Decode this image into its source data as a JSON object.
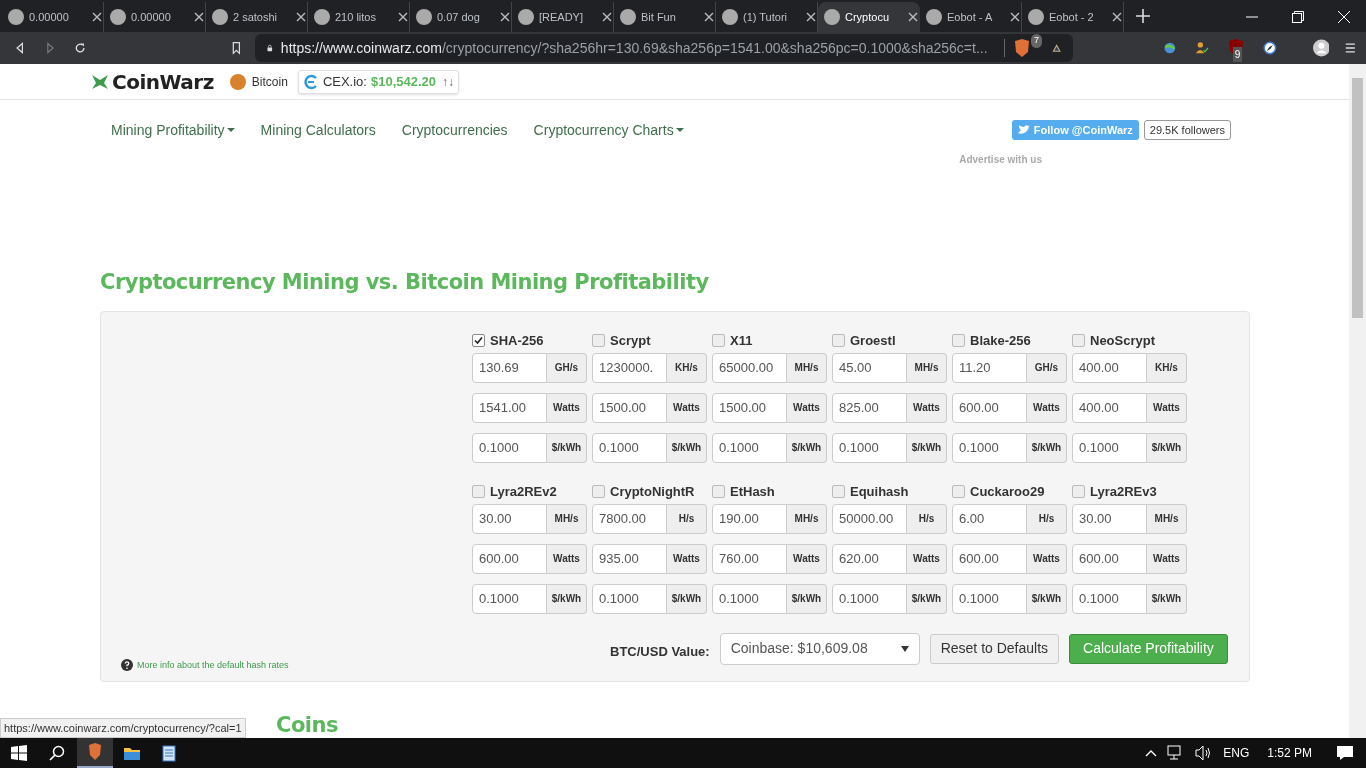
{
  "browser": {
    "tabs": [
      {
        "title": "0.00000",
        "selected": false
      },
      {
        "title": "0.00000",
        "selected": false
      },
      {
        "title": "2 satoshi",
        "selected": false
      },
      {
        "title": "210 litos",
        "selected": false
      },
      {
        "title": "0.07 dog",
        "selected": false
      },
      {
        "title": "[READY]",
        "selected": false
      },
      {
        "title": "Bit Fun",
        "selected": false
      },
      {
        "title": "(1) Tutori",
        "selected": false
      },
      {
        "title": "Cryptocu",
        "selected": true
      },
      {
        "title": "Eobot - A",
        "selected": false
      },
      {
        "title": "Eobot - 2",
        "selected": false
      }
    ],
    "url_host": "https://www.coinwarz.com",
    "url_path": "/cryptocurrency/?sha256hr=130.69&sha256p=1541.00&sha256pc=0.1000&sha256c=t...",
    "shield_count": "7",
    "ublock_count": "9"
  },
  "header": {
    "logo": "CoinWarz",
    "coin": "Bitcoin",
    "exchange": "CEX.io:",
    "price": "$10,542.20",
    "arrows": "↑↓"
  },
  "nav": [
    {
      "label": "Mining Profitability",
      "dropdown": true
    },
    {
      "label": "Mining Calculators",
      "dropdown": false
    },
    {
      "label": "Cryptocurrencies",
      "dropdown": false
    },
    {
      "label": "Cryptocurrency Charts",
      "dropdown": true
    }
  ],
  "twitter": {
    "button": "Follow @CoinWarz",
    "followers": "29.5K followers"
  },
  "advertise": "Advertise with us",
  "title": "Cryptocurrency Mining vs. Bitcoin Mining Profitability",
  "algorithms": [
    {
      "name": "SHA-256",
      "checked": true,
      "hashrate": "130.69",
      "hash_unit": "GH/s",
      "power": "1541.00",
      "power_unit": "Watts",
      "cost": "0.1000",
      "cost_unit": "$/kWh"
    },
    {
      "name": "Scrypt",
      "checked": false,
      "hashrate": "1230000.",
      "hash_unit": "KH/s",
      "power": "1500.00",
      "power_unit": "Watts",
      "cost": "0.1000",
      "cost_unit": "$/kWh"
    },
    {
      "name": "X11",
      "checked": false,
      "hashrate": "65000.00",
      "hash_unit": "MH/s",
      "power": "1500.00",
      "power_unit": "Watts",
      "cost": "0.1000",
      "cost_unit": "$/kWh"
    },
    {
      "name": "Groestl",
      "checked": false,
      "hashrate": "45.00",
      "hash_unit": "MH/s",
      "power": "825.00",
      "power_unit": "Watts",
      "cost": "0.1000",
      "cost_unit": "$/kWh"
    },
    {
      "name": "Blake-256",
      "checked": false,
      "hashrate": "11.20",
      "hash_unit": "GH/s",
      "power": "600.00",
      "power_unit": "Watts",
      "cost": "0.1000",
      "cost_unit": "$/kWh"
    },
    {
      "name": "NeoScrypt",
      "checked": false,
      "hashrate": "400.00",
      "hash_unit": "KH/s",
      "power": "400.00",
      "power_unit": "Watts",
      "cost": "0.1000",
      "cost_unit": "$/kWh"
    },
    {
      "name": "Lyra2REv2",
      "checked": false,
      "hashrate": "30.00",
      "hash_unit": "MH/s",
      "power": "600.00",
      "power_unit": "Watts",
      "cost": "0.1000",
      "cost_unit": "$/kWh"
    },
    {
      "name": "CryptoNightR",
      "checked": false,
      "hashrate": "7800.00",
      "hash_unit": "H/s",
      "power": "935.00",
      "power_unit": "Watts",
      "cost": "0.1000",
      "cost_unit": "$/kWh"
    },
    {
      "name": "EtHash",
      "checked": false,
      "hashrate": "190.00",
      "hash_unit": "MH/s",
      "power": "760.00",
      "power_unit": "Watts",
      "cost": "0.1000",
      "cost_unit": "$/kWh"
    },
    {
      "name": "Equihash",
      "checked": false,
      "hashrate": "50000.00",
      "hash_unit": "H/s",
      "power": "620.00",
      "power_unit": "Watts",
      "cost": "0.1000",
      "cost_unit": "$/kWh"
    },
    {
      "name": "Cuckaroo29",
      "checked": false,
      "hashrate": "6.00",
      "hash_unit": "H/s",
      "power": "600.00",
      "power_unit": "Watts",
      "cost": "0.1000",
      "cost_unit": "$/kWh"
    },
    {
      "name": "Lyra2REv3",
      "checked": false,
      "hashrate": "30.00",
      "hash_unit": "MH/s",
      "power": "600.00",
      "power_unit": "Watts",
      "cost": "0.1000",
      "cost_unit": "$/kWh"
    }
  ],
  "info_link": "More info about the default hash rates",
  "btc_label": "BTC/USD Value:",
  "btc_value": "Coinbase: $10,609.08",
  "buttons": {
    "reset": "Reset to Defaults",
    "calculate": "Calculate Profitability"
  },
  "section2": "Coins",
  "status_url": "https://www.coinwarz.com/cryptocurrency/?cal=1",
  "taskbar": {
    "language": "ENG",
    "time": "1:52 PM"
  }
}
